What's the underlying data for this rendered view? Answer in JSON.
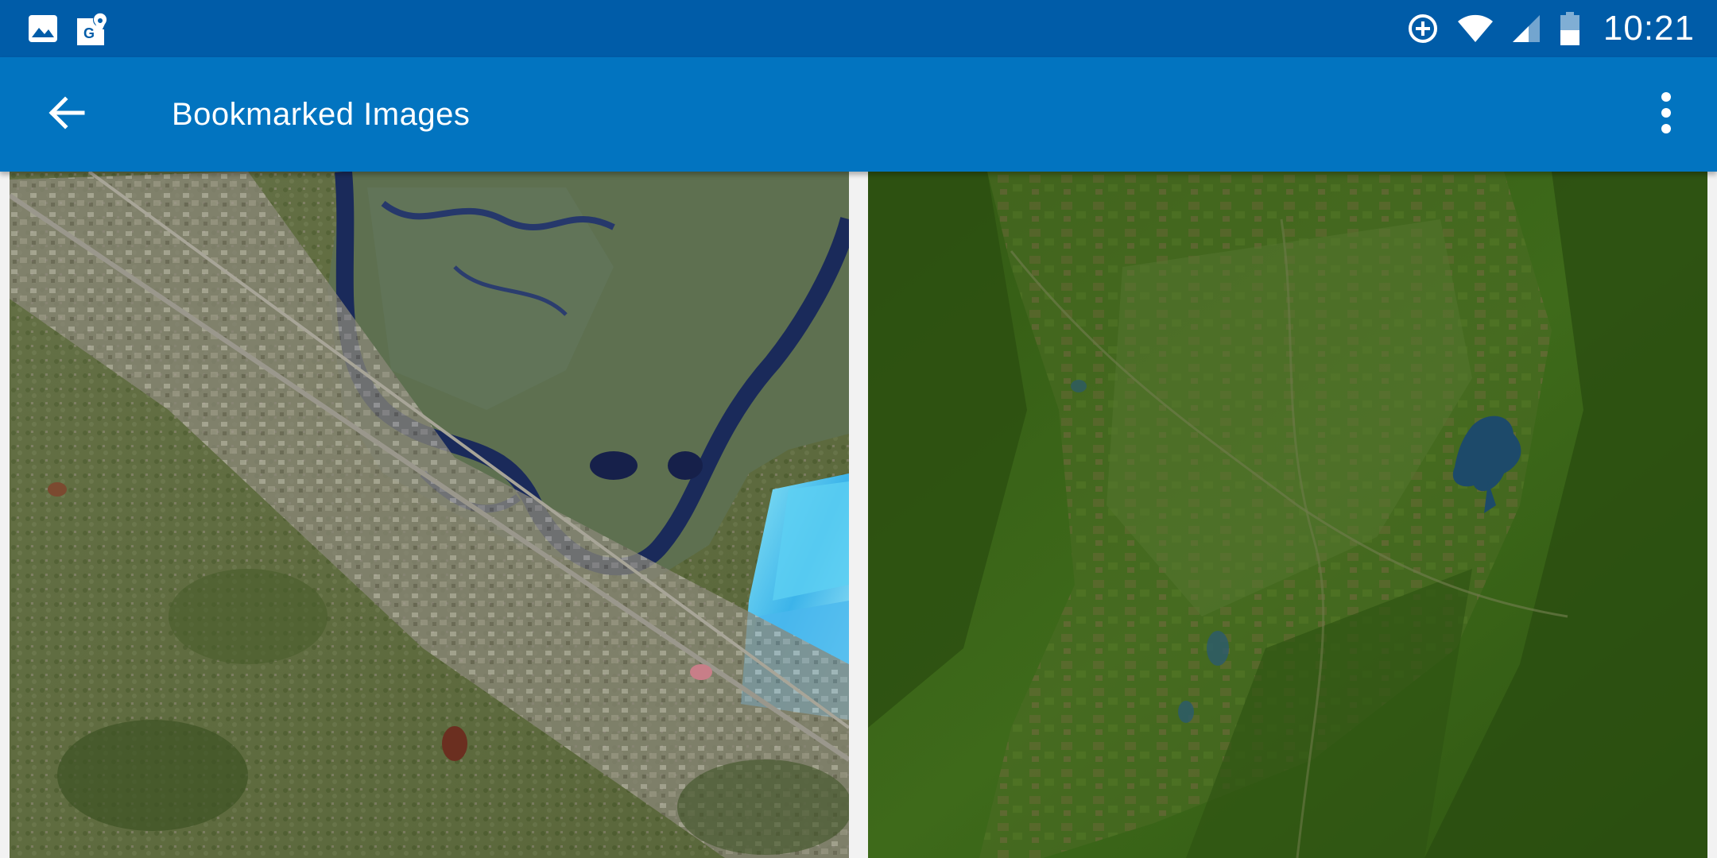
{
  "status_bar": {
    "left_icons": [
      "image-icon",
      "google-maps-icon"
    ],
    "right_icons": [
      "data-saver-icon",
      "wifi-icon",
      "cell-signal-icon",
      "battery-icon"
    ],
    "time": "10:21"
  },
  "app_bar": {
    "back_icon": "arrow-back-icon",
    "title": "Bookmarked Images",
    "menu_icon": "more-vert-icon"
  },
  "grid": {
    "tiles": [
      {
        "description_icon": "satellite-image-bay-area-icon"
      },
      {
        "description_icon": "satellite-image-forest-lake-icon"
      }
    ]
  },
  "colors": {
    "status_bar": "#005ca8",
    "app_bar": "#0274c0",
    "background": "#f2f2f2"
  }
}
